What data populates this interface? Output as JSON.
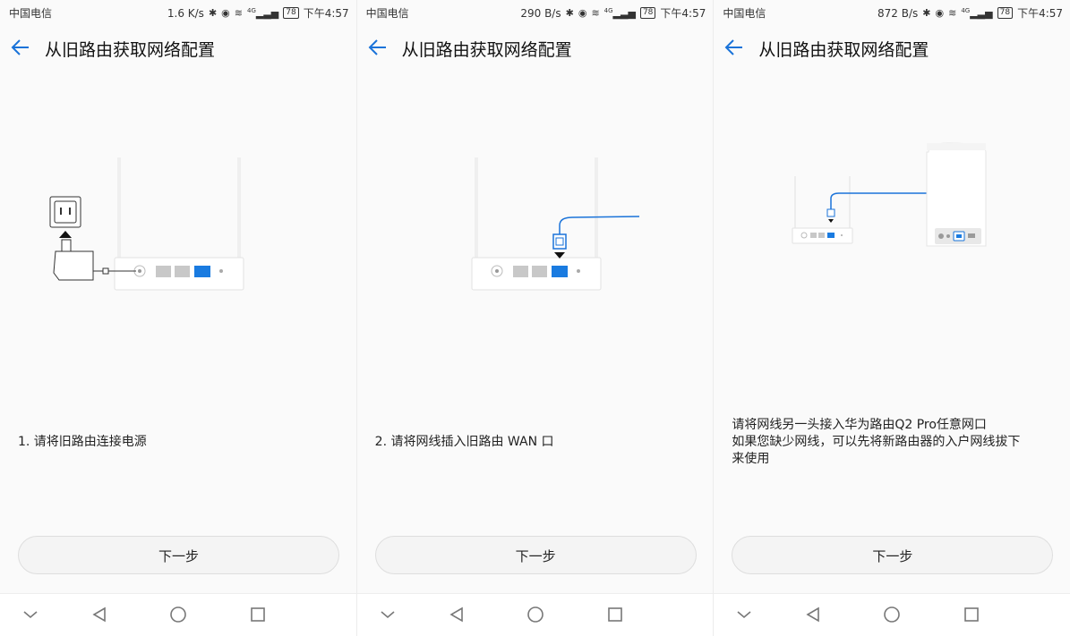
{
  "screens": [
    {
      "status": {
        "carrier": "中国电信",
        "speed": "1.6 K/s",
        "network": "4G",
        "battery": "78",
        "time": "下午4:57"
      },
      "header": {
        "title": "从旧路由获取网络配置"
      },
      "instruction": [
        "1. 请将旧路由连接电源"
      ],
      "next_label": "下一步"
    },
    {
      "status": {
        "carrier": "中国电信",
        "speed": "290 B/s",
        "network": "4G",
        "battery": "78",
        "time": "下午4:57"
      },
      "header": {
        "title": "从旧路由获取网络配置"
      },
      "instruction": [
        "2. 请将网线插入旧路由 WAN 口"
      ],
      "next_label": "下一步"
    },
    {
      "status": {
        "carrier": "中国电信",
        "speed": "872 B/s",
        "network": "4G",
        "battery": "78",
        "time": "下午4:57"
      },
      "header": {
        "title": "从旧路由获取网络配置"
      },
      "instruction": [
        "请将网线另一头接入华为路由Q2 Pro任意网口",
        "如果您缺少网线，可以先将新路由器的入户网线拔下",
        "来使用"
      ],
      "next_label": "下一步"
    }
  ],
  "icons": {
    "back": "arrow-left-icon",
    "bluetooth": "bluetooth-icon",
    "eye": "eye-comfort-icon",
    "wifi": "wifi-icon",
    "signal": "signal-icon",
    "nav": [
      "chevron-down-icon",
      "back-triangle-icon",
      "home-circle-icon",
      "recents-square-icon"
    ]
  },
  "colors": {
    "accent": "#1a73d9",
    "port_blue": "#1a7be0",
    "port_grey": "#c8c8c8"
  }
}
